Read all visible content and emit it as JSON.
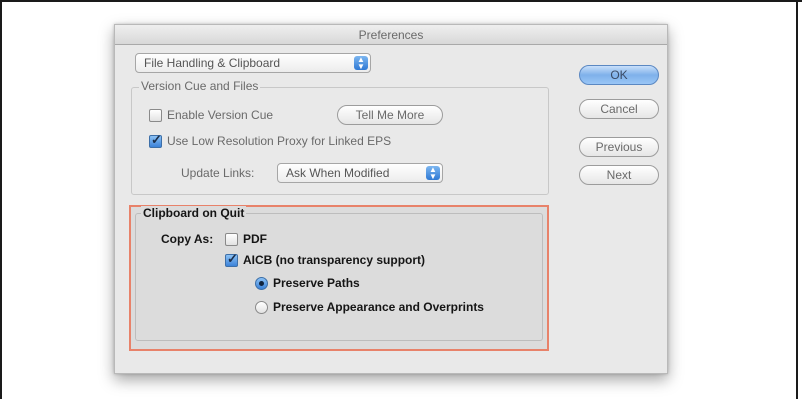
{
  "dialog": {
    "title": "Preferences"
  },
  "category_popup": {
    "value": "File Handling & Clipboard"
  },
  "version_cue": {
    "group_title": "Version Cue and Files",
    "enable_label": "Enable Version Cue",
    "enable_checked": false,
    "tell_me_more_label": "Tell Me More",
    "low_res_label": "Use Low Resolution Proxy for Linked EPS",
    "low_res_checked": true,
    "update_links_label": "Update Links:",
    "update_links_value": "Ask When Modified"
  },
  "clipboard": {
    "group_title": "Clipboard on Quit",
    "copy_as_label": "Copy As:",
    "pdf_label": "PDF",
    "pdf_checked": false,
    "aicb_label": "AICB (no transparency support)",
    "aicb_checked": true,
    "preserve_paths_label": "Preserve Paths",
    "preserve_paths_selected": true,
    "preserve_appearance_label": "Preserve Appearance and Overprints",
    "preserve_appearance_selected": false
  },
  "buttons": {
    "ok": "OK",
    "cancel": "Cancel",
    "previous": "Previous",
    "next": "Next"
  },
  "colors": {
    "highlight_border": "#e8826a",
    "default_button": "#7fb1ea"
  }
}
